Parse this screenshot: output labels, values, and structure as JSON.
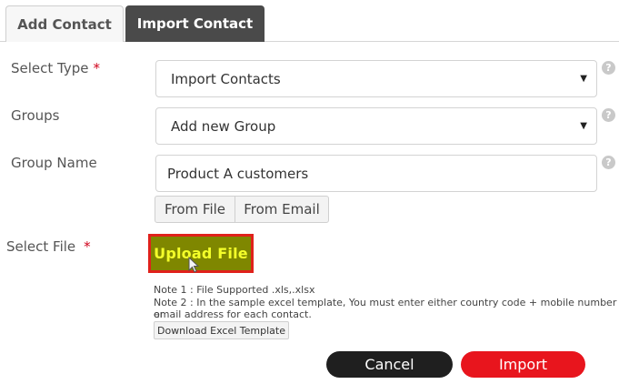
{
  "tabs": {
    "add_contact": "Add Contact",
    "import_contact": "Import Contact"
  },
  "form": {
    "select_type": {
      "label": "Select Type",
      "required_mark": "*",
      "value": "Import Contacts"
    },
    "groups": {
      "label": "Groups",
      "value": "Add new Group"
    },
    "group_name": {
      "label": "Group Name",
      "value": "Product A customers"
    },
    "source_options": [
      "From File",
      "From Email"
    ],
    "select_file": {
      "label": "Select File",
      "required_mark": "*",
      "upload_label": "Upload File"
    },
    "note1": "Note 1 : File Supported .xls,.xlsx",
    "note2_line1": "Note 2 : In the sample excel template, You must enter either country code + mobile number or",
    "note2_line2": "email address for each contact.",
    "download_template": "Download Excel Template"
  },
  "help_glyph": "?",
  "dropdown_glyph": "▼",
  "actions": {
    "cancel": "Cancel",
    "import": "Import"
  },
  "colors": {
    "active_tab": "#4a4a4a",
    "import_button": "#e8151d",
    "cancel_button": "#1f1f1f",
    "upload_highlight": "#7f8700",
    "upload_border": "#e0211b"
  }
}
